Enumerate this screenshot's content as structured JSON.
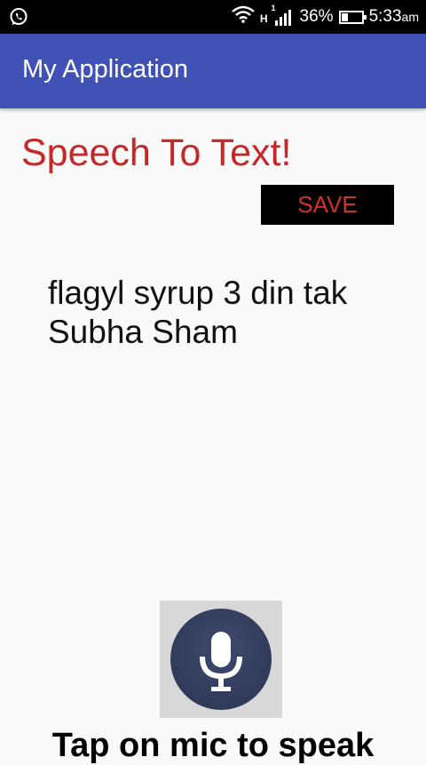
{
  "status_bar": {
    "network_type": "H",
    "sim_indicator": "1",
    "battery_percent": "36%",
    "battery_level": 0.36,
    "time": "5:33",
    "time_suffix": "am",
    "icons": [
      "whatsapp-icon",
      "wifi-icon",
      "signal-icon",
      "battery-icon"
    ]
  },
  "app_bar": {
    "title": "My Application",
    "color": "#3f51b5"
  },
  "main": {
    "heading": "Speech To Text!",
    "save_label": "SAVE",
    "result_text": "flagyl syrup 3 din tak Subha Sham",
    "mic_icon": "microphone-icon",
    "tap_label": "Tap on mic to speak"
  },
  "colors": {
    "heading": "#c62828",
    "save_text": "#d32f2f",
    "save_bg": "#000000",
    "mic_circle": "#2b3452"
  }
}
